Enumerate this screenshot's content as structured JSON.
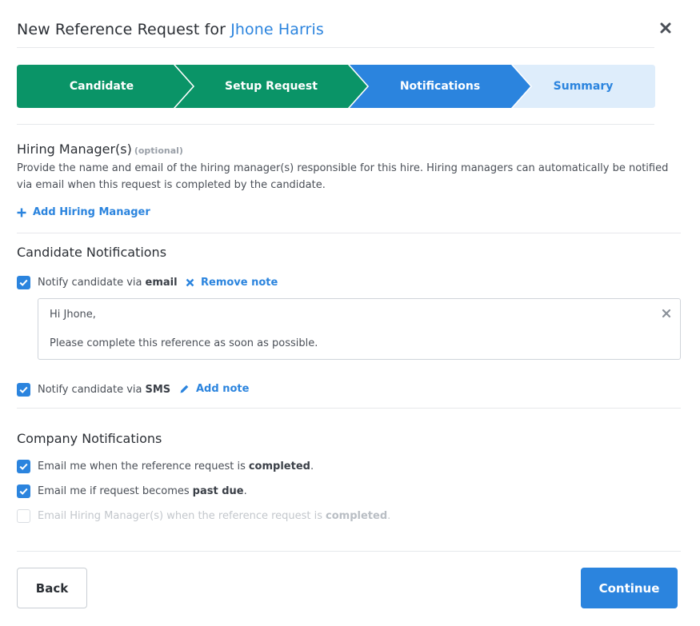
{
  "header": {
    "title_prefix": "New Reference Request for",
    "candidate_name": "Jhone Harris",
    "close_icon": "close-icon"
  },
  "stepper": {
    "steps": [
      {
        "label": "Candidate",
        "state": "complete",
        "color": "#0a9467"
      },
      {
        "label": "Setup Request",
        "state": "complete",
        "color": "#0a9467"
      },
      {
        "label": "Notifications",
        "state": "active",
        "color": "#2b84de"
      },
      {
        "label": "Summary",
        "state": "upcoming",
        "color": "#deedfb"
      }
    ]
  },
  "hiring_managers": {
    "title": "Hiring Manager(s)",
    "optional": "(optional)",
    "description": "Provide the name and email of the hiring manager(s) responsible for this hire. Hiring managers can automatically be notified via email when this request is completed by the candidate.",
    "add_label": "Add Hiring Manager",
    "add_icon": "plus-icon"
  },
  "candidate_notifications": {
    "title": "Candidate Notifications",
    "email": {
      "label": "Notify candidate via",
      "channel": "email",
      "checked": true,
      "remove_note_label": "Remove note",
      "remove_icon": "close-icon"
    },
    "note": {
      "greeting": "Hi Jhone,",
      "body": "Please complete this reference as soon as possible."
    },
    "sms": {
      "label": "Notify candidate via",
      "channel": "SMS",
      "checked": true,
      "add_note_label": "Add note",
      "add_icon": "pencil-icon"
    }
  },
  "company_notifications": {
    "title": "Company Notifications",
    "items": [
      {
        "text": "Email me when the reference request is",
        "bold": "completed",
        "suffix": ".",
        "checked": true,
        "disabled": false
      },
      {
        "text": "Email me if request becomes",
        "bold": "past due",
        "suffix": ".",
        "checked": true,
        "disabled": false
      },
      {
        "text": "Email Hiring Manager(s) when the reference request is",
        "bold": "completed",
        "suffix": ".",
        "checked": false,
        "disabled": true
      }
    ]
  },
  "footer": {
    "back_label": "Back",
    "continue_label": "Continue"
  },
  "colors": {
    "accent": "#2b84de",
    "complete": "#0a9467",
    "upcoming": "#deedfb"
  }
}
